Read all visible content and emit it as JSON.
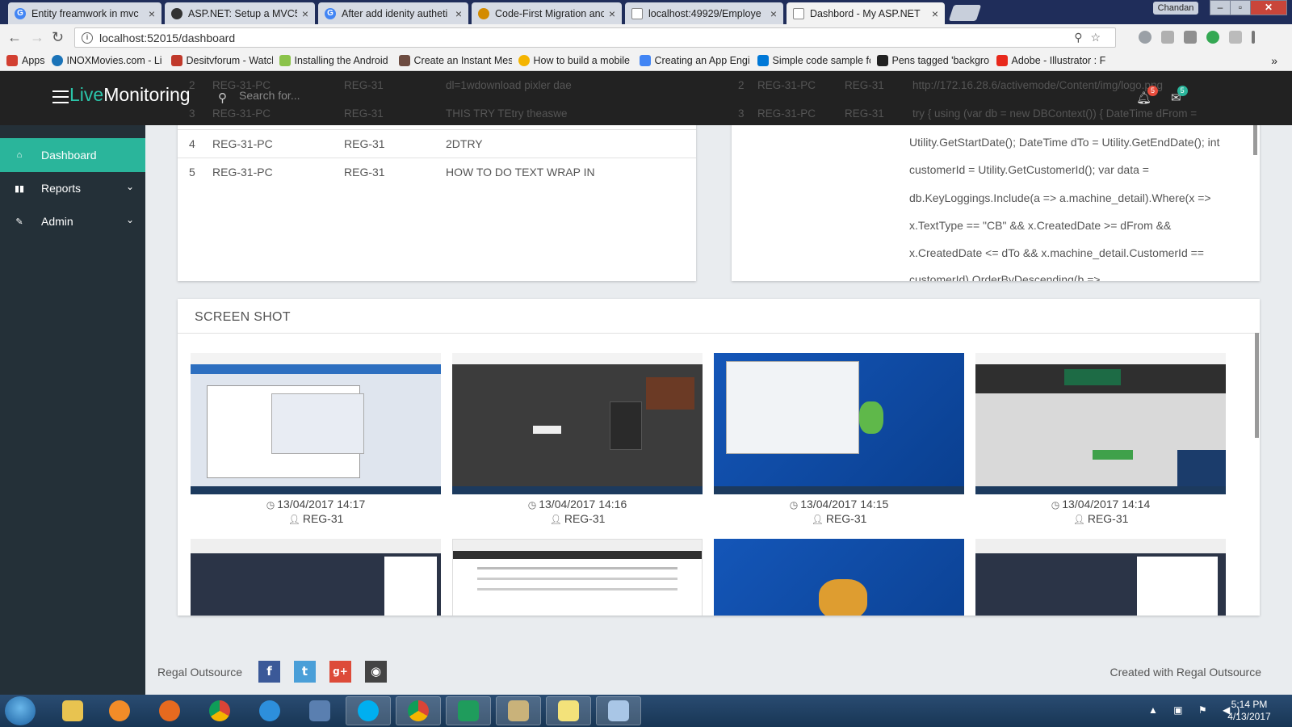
{
  "browser": {
    "tabs": [
      {
        "title": "Entity freamwork in mvc",
        "favicon": "google-icon",
        "color": "#4285f4",
        "active": false
      },
      {
        "title": "ASP.NET: Setup a MVC5",
        "favicon": "codeproject-icon",
        "color": "#333333",
        "active": false
      },
      {
        "title": "After add idenity autheti",
        "favicon": "google-icon",
        "color": "#4285f4",
        "active": false
      },
      {
        "title": "Code-First Migration anc",
        "favicon": "csharpcorner-icon",
        "color": "#d38b00",
        "active": false
      },
      {
        "title": "localhost:49929/Employe",
        "favicon": "page-icon",
        "color": "#888888",
        "active": false
      },
      {
        "title": "Dashbord - My ASP.NET",
        "favicon": "page-icon",
        "color": "#888888",
        "active": true
      }
    ],
    "user_name": "Chandan",
    "url": "localhost:52015/dashboard",
    "bookmarks": [
      {
        "label": "Apps",
        "icon": "apps-grid-icon",
        "color": "#d23f31"
      },
      {
        "label": "INOXMovies.com - Li",
        "icon": "inox-icon",
        "color": "#1a73b8"
      },
      {
        "label": "Desitvforum - Watch",
        "icon": "desitv-icon",
        "color": "#c0392b"
      },
      {
        "label": "Installing the Android",
        "icon": "android-icon",
        "color": "#8bc34a"
      },
      {
        "label": "Create an Instant Mes",
        "icon": "bookmark-icon",
        "color": "#6d4c41"
      },
      {
        "label": "How to build a mobile",
        "icon": "chrome-icon",
        "color": "#f4b400"
      },
      {
        "label": "Creating an App Engi",
        "icon": "appengine-icon",
        "color": "#4285f4"
      },
      {
        "label": "Simple code sample fo",
        "icon": "msdn-icon",
        "color": "#0078d7"
      },
      {
        "label": "Pens tagged 'backgro",
        "icon": "codepen-icon",
        "color": "#222222"
      },
      {
        "label": "Adobe - Illustrator : F",
        "icon": "adobe-icon",
        "color": "#e8291c"
      }
    ]
  },
  "app": {
    "brand_live": "Live",
    "brand_monitoring": "Monitoring",
    "search_placeholder": "Search for...",
    "notifications_count": "5",
    "messages_count": "5",
    "accent_color": "#2ab59b",
    "sidebar": [
      {
        "label": "Dashboard",
        "icon": "home-icon",
        "active": true,
        "expandable": false
      },
      {
        "label": "Reports",
        "icon": "bar-chart-icon",
        "active": false,
        "expandable": true
      },
      {
        "label": "Admin",
        "icon": "edit-icon",
        "active": false,
        "expandable": true
      }
    ]
  },
  "left_table": {
    "ghost_rows": [
      {
        "no": "2",
        "machine": "REG-31-PC",
        "user": "REG-31",
        "text": "dl=1wdownload pixler dae"
      },
      {
        "no": "3",
        "machine": "REG-31-PC",
        "user": "REG-31",
        "text": "THIS TRY TEtry theaswe"
      }
    ],
    "rows": [
      {
        "no": "4",
        "machine": "REG-31-PC",
        "user": "REG-31",
        "text": "2DTRY"
      },
      {
        "no": "5",
        "machine": "REG-31-PC",
        "user": "REG-31",
        "text": "HOW TO DO TEXT WRAP IN"
      }
    ]
  },
  "right_table": {
    "ghost_rows": [
      {
        "no": "2",
        "machine": "REG-31-PC",
        "user": "REG-31",
        "text": "http://172.16.28.6/activemode/Content/img/logo.png"
      },
      {
        "no": "3",
        "machine": "REG-31-PC",
        "user": "REG-31",
        "text": "try { using (var db = new DBContext()) { DateTime dFrom ="
      }
    ],
    "code_lines": [
      "Utility.GetStartDate(); DateTime dTo = Utility.GetEndDate(); int",
      "customerId = Utility.GetCustomerId(); var data =",
      "db.KeyLoggings.Include(a => a.machine_detail).Where(x =>",
      "x.TextType == \"CB\" && x.CreatedDate >= dFrom &&",
      "x.CreatedDate <= dTo && x.machine_detail.CustomerId ==",
      "customerId).OrderByDescending(b =>"
    ]
  },
  "screenshots": {
    "title": "SCREEN SHOT",
    "items": [
      {
        "time": "13/04/2017 14:17",
        "user": "REG-31",
        "style": "explorer"
      },
      {
        "time": "13/04/2017 14:16",
        "user": "REG-31",
        "style": "pixlr-dark"
      },
      {
        "time": "13/04/2017 14:15",
        "user": "REG-31",
        "style": "desktop-blue"
      },
      {
        "time": "13/04/2017 14:14",
        "user": "REG-31",
        "style": "uptodown"
      },
      {
        "time": "",
        "user": "",
        "style": "vs-dark"
      },
      {
        "time": "",
        "user": "",
        "style": "pixlr-web"
      },
      {
        "time": "",
        "user": "",
        "style": "desktop-blue"
      },
      {
        "time": "",
        "user": "",
        "style": "vs-dark"
      }
    ]
  },
  "footer": {
    "left": "Regal Outsource",
    "right": "Created with Regal Outsource",
    "social": [
      {
        "name": "facebook-icon",
        "glyph": "f",
        "color": "#3b5998"
      },
      {
        "name": "twitter-icon",
        "glyph": "t",
        "color": "#4a9fd8"
      },
      {
        "name": "google-plus-icon",
        "glyph": "g+",
        "color": "#dd4b39"
      },
      {
        "name": "github-icon",
        "glyph": "gh",
        "color": "#444444"
      }
    ]
  },
  "taskbar": {
    "time": "5:14 PM",
    "date": "4/13/2017"
  }
}
